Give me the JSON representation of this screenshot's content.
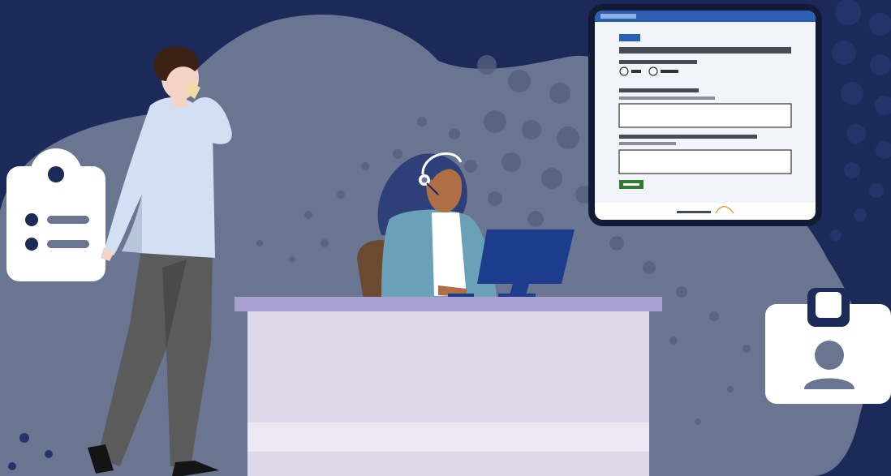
{
  "scene": {
    "background_color": "#1b2a59",
    "blob_color": "#6a7592",
    "accent_blue": "#2a5fb4",
    "submit_color": "#2e7d32",
    "desk_top_color": "#a8a0d0",
    "desk_front_color": "#dcd8ea"
  },
  "clipboard_icon": {
    "icon": "clipboard-list-icon"
  },
  "badge_icon": {
    "icon": "id-badge-icon"
  },
  "man": {
    "icon": "person-on-phone"
  },
  "agent": {
    "icon": "support-agent-headset"
  },
  "tablet": {
    "form": {
      "radio_options": 2,
      "input_fields": 2
    }
  }
}
